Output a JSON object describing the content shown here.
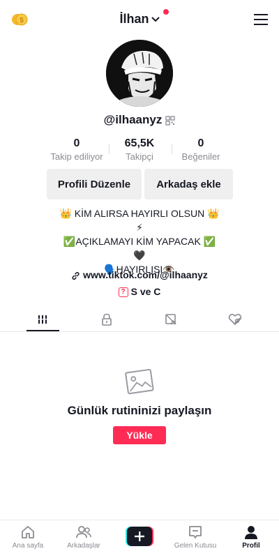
{
  "header": {
    "username": "İlhan",
    "icons": {
      "coin": "coin-icon",
      "chevron": "chevron-down-icon",
      "menu": "hamburger-menu-icon"
    },
    "notification_color": "#fe2c55"
  },
  "profile": {
    "handle": "@ilhaanyz",
    "stats": [
      {
        "value": "0",
        "label": "Takip ediliyor"
      },
      {
        "value": "65,5K",
        "label": "Takipçi"
      },
      {
        "value": "0",
        "label": "Beğeniler"
      }
    ],
    "buttons": {
      "edit_profile": "Profili Düzenle",
      "add_friend": "Arkadaş ekle"
    },
    "bio_lines": [
      "👑 KİM ALIRSA HAYIRLI OLSUN 👑",
      "⚡",
      "✅AÇIKLAMAYI KİM YAPACAK ✅",
      "🖤",
      "🗣️HAYIRLISI👁️"
    ],
    "link": "www.tiktok.com/@ilhaanyz",
    "qa_label": "S ve C"
  },
  "tabs": [
    {
      "name": "videos-grid-icon",
      "active": true
    },
    {
      "name": "lock-icon",
      "active": false
    },
    {
      "name": "tagged-icon",
      "active": false
    },
    {
      "name": "liked-hidden-icon",
      "active": false
    }
  ],
  "empty_state": {
    "title": "Günlük rutininizi paylaşın",
    "button": "Yükle"
  },
  "bottom_nav": {
    "home": "Ana sayfa",
    "friends": "Arkadaşlar",
    "inbox": "Gelen Kutusu",
    "profile": "Profil"
  },
  "colors": {
    "accent": "#fe2c55",
    "text": "#161823",
    "muted": "#8a8b91"
  }
}
